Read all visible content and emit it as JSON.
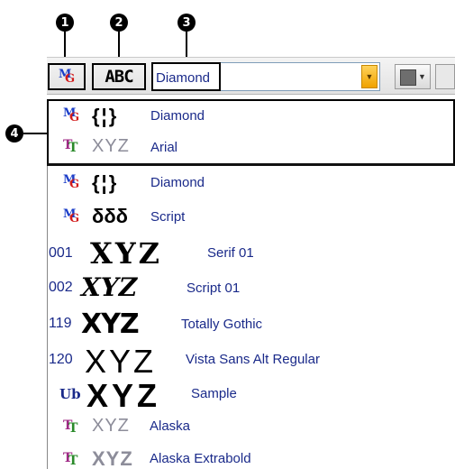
{
  "callouts": [
    "1",
    "2",
    "3",
    "4"
  ],
  "toolbar": {
    "font_name": "Diamond",
    "abc_label": "ABC"
  },
  "recent_fonts": [
    {
      "icon": "mg",
      "sample": "{¦}",
      "name": "Diamond"
    },
    {
      "icon": "tt",
      "sample": "XYZ",
      "name": "Arial"
    }
  ],
  "font_list": [
    {
      "icon": "mg",
      "sample": "{¦}",
      "name": "Diamond"
    },
    {
      "icon": "mg",
      "sample": "δδδ",
      "name": "Script"
    },
    {
      "number": "001",
      "sample": "XYZ",
      "name": "Serif 01"
    },
    {
      "number": "002",
      "sample": "XYZ",
      "name": "Script 01"
    },
    {
      "number": "119",
      "sample": "XYZ",
      "name": "Totally Gothic"
    },
    {
      "number": "120",
      "sample": "XYZ",
      "name": "Vista Sans Alt Regular"
    },
    {
      "icon": "ud",
      "icon_text": "Ub",
      "sample": "XYZ",
      "name": "Sample"
    },
    {
      "icon": "tt",
      "sample": "XYZ",
      "name": "Alaska"
    },
    {
      "icon": "tt",
      "sample": "XYZ",
      "name": "Alaska Extrabold"
    }
  ]
}
